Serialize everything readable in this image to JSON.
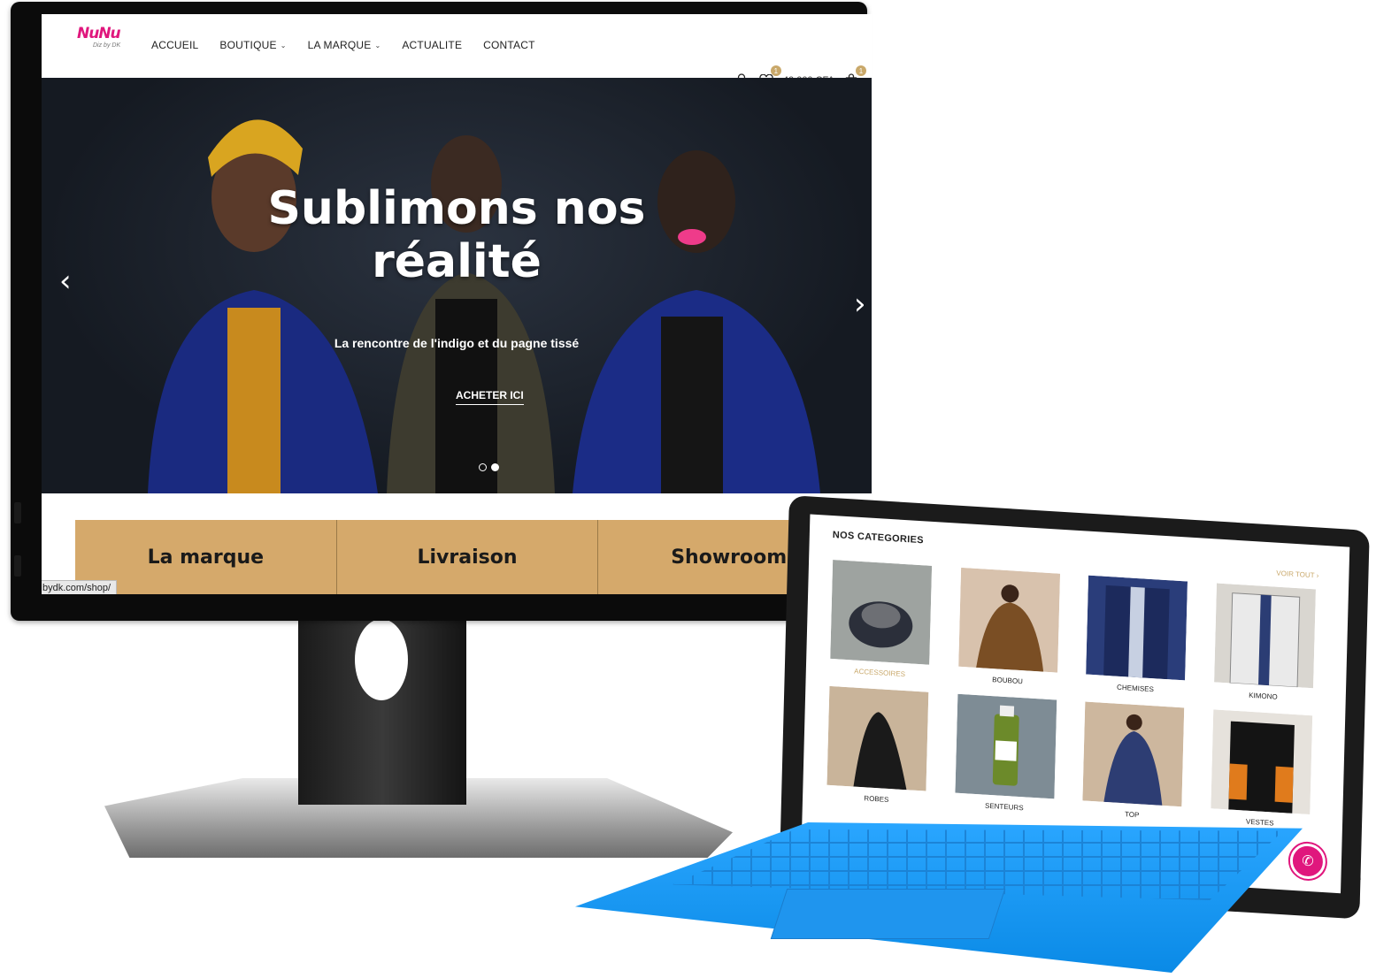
{
  "site": {
    "logo_text": "NuNu",
    "logo_sub": "Diz by DK",
    "nav": [
      {
        "label": "ACCUEIL",
        "dropdown": false
      },
      {
        "label": "BOUTIQUE",
        "dropdown": true
      },
      {
        "label": "LA MARQUE",
        "dropdown": true
      },
      {
        "label": "ACTUALITE",
        "dropdown": false
      },
      {
        "label": "CONTACT",
        "dropdown": false
      }
    ],
    "wishlist_count": "1",
    "cart_total": "40.000 CFA",
    "cart_count": "1"
  },
  "hero": {
    "title_line1": "Sublimons nos",
    "title_line2": "réalité",
    "subtitle": "La rencontre de l'indigo et du pagne tissé",
    "cta": "ACHETER ICI"
  },
  "features": [
    "La marque",
    "Livraison",
    "Showroom"
  ],
  "status_url": "bydk.com/shop/",
  "tablet": {
    "section_title": "NOS CATEGORIES",
    "see_all": "VOIR TOUT",
    "categories": [
      {
        "label": "ACCESSOIRES",
        "active": true
      },
      {
        "label": "BOUBOU"
      },
      {
        "label": "CHEMISES"
      },
      {
        "label": "KIMONO"
      },
      {
        "label": "ROBES"
      },
      {
        "label": "SENTEURS"
      },
      {
        "label": "TOP"
      },
      {
        "label": "VESTES"
      }
    ]
  },
  "colors": {
    "accent": "#c9a86a",
    "brand_pink": "#e0177d",
    "feature_bg": "#d5a96b",
    "keyboard_blue": "#1592f0"
  }
}
